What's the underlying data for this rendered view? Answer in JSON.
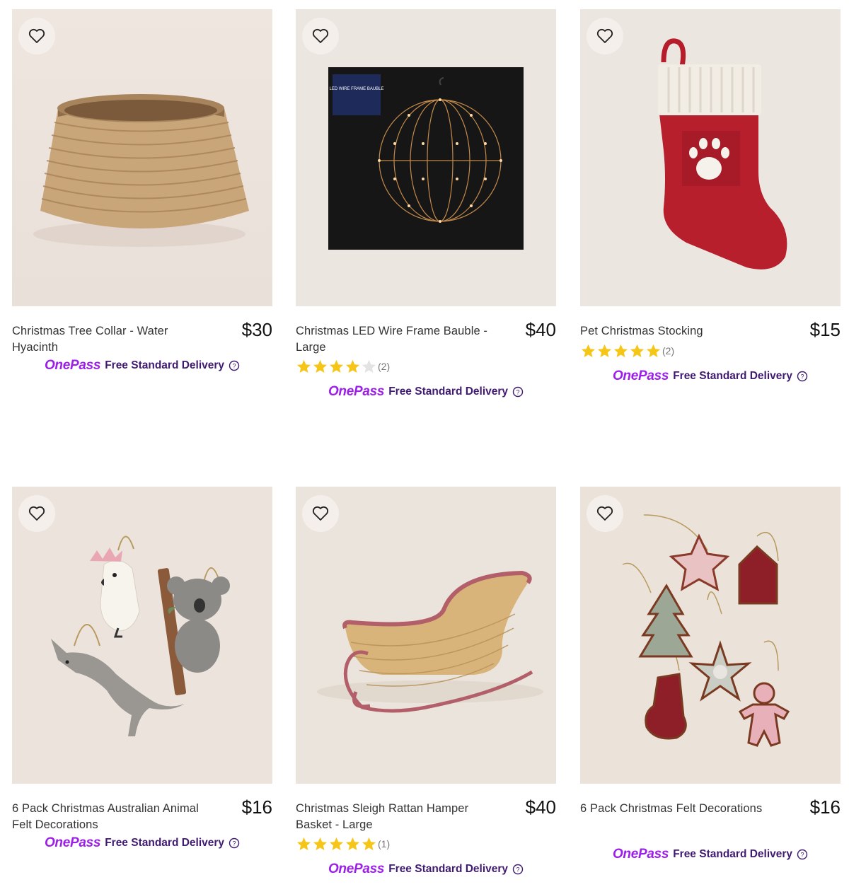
{
  "brand_colors": {
    "onepass_purple": "#9b1fe8",
    "delivery_text": "#3f1a70",
    "star_gold": "#f5c518"
  },
  "onepass_label": "OnePass",
  "delivery_label": "Free Standard Delivery",
  "products": [
    {
      "title": "Christmas Tree Collar - Water Hyacinth",
      "price": "$30",
      "rating": null,
      "review_count": null,
      "image": "woven-tree-collar"
    },
    {
      "title": "Christmas LED Wire Frame Bauble - Large",
      "price": "$40",
      "rating": 4,
      "review_count": "(2)",
      "image": "led-wire-bauble",
      "box_text": "LED WIRE FRAME BAUBLE"
    },
    {
      "title": "Pet Christmas Stocking",
      "price": "$15",
      "rating": 5,
      "review_count": "(2)",
      "image": "red-paw-stocking"
    },
    {
      "title": "6 Pack Christmas Australian Animal Felt Decorations",
      "price": "$16",
      "rating": null,
      "review_count": null,
      "image": "felt-animal-ornaments"
    },
    {
      "title": "Christmas Sleigh Rattan Hamper Basket - Large",
      "price": "$40",
      "rating": 5,
      "review_count": "(1)",
      "image": "rattan-sleigh"
    },
    {
      "title": "6 Pack Christmas Felt Decorations",
      "price": "$16",
      "rating": null,
      "review_count": null,
      "image": "felt-ornaments"
    }
  ]
}
